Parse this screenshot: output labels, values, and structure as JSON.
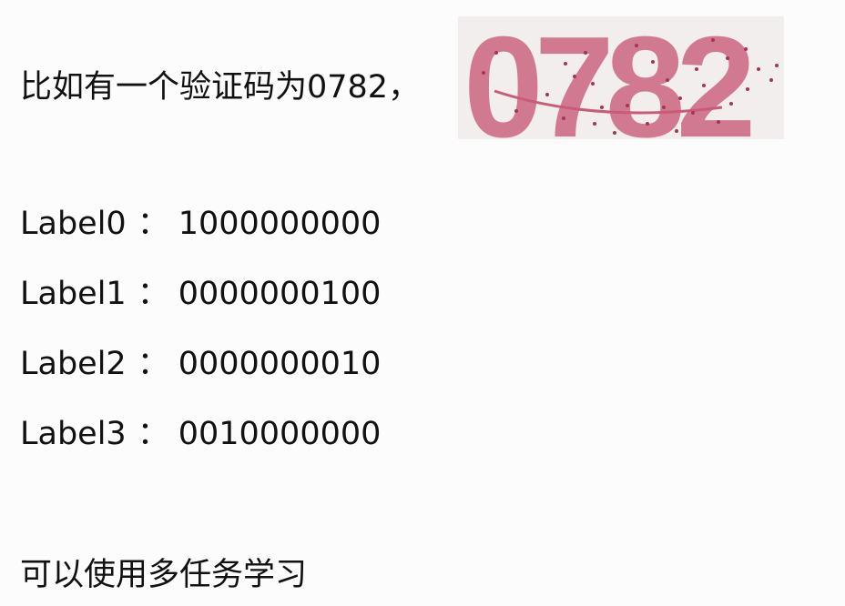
{
  "intro_text": "比如有一个验证码为0782，",
  "captcha": {
    "digits": "0782",
    "color": "#c95b78"
  },
  "labels": [
    {
      "name": "Label0",
      "value": "1000000000"
    },
    {
      "name": "Label1",
      "value": "0000000100"
    },
    {
      "name": "Label2",
      "value": "0000000010"
    },
    {
      "name": "Label3",
      "value": "0010000000"
    }
  ],
  "separator": "：",
  "footer_text": "可以使用多任务学习"
}
